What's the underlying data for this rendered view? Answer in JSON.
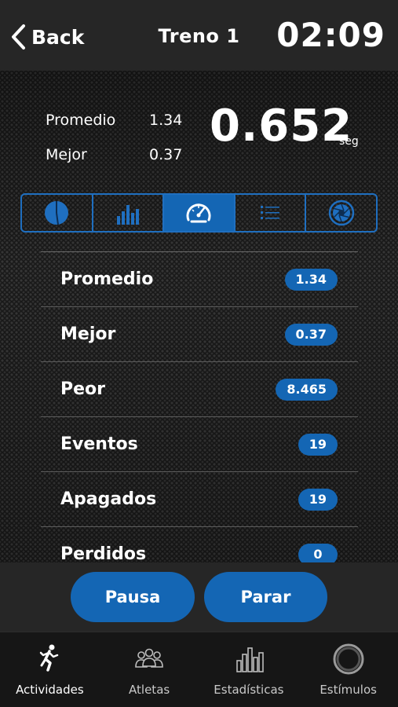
{
  "header": {
    "back_label": "Back",
    "title": "Treno 1",
    "clock": "02:09"
  },
  "summary": {
    "rows": [
      {
        "label": "Promedio",
        "value": "1.34"
      },
      {
        "label": "Mejor",
        "value": "0.37"
      }
    ],
    "current_value": "0.652",
    "unit": "seg"
  },
  "view_tabs": [
    {
      "icon": "pie-chart-icon",
      "active": false
    },
    {
      "icon": "bar-chart-icon",
      "active": false
    },
    {
      "icon": "speedometer-icon",
      "active": true
    },
    {
      "icon": "list-icon",
      "active": false
    },
    {
      "icon": "shutter-icon",
      "active": false
    }
  ],
  "stats": [
    {
      "label": "Promedio",
      "value": "1.34"
    },
    {
      "label": "Mejor",
      "value": "0.37"
    },
    {
      "label": "Peor",
      "value": "8.465"
    },
    {
      "label": "Eventos",
      "value": "19"
    },
    {
      "label": "Apagados",
      "value": "19"
    },
    {
      "label": "Perdidos",
      "value": "0"
    }
  ],
  "actions": {
    "pause_label": "Pausa",
    "stop_label": "Parar"
  },
  "tabbar": [
    {
      "label": "Actividades",
      "icon": "runner-icon",
      "active": true
    },
    {
      "label": "Atletas",
      "icon": "athletes-icon",
      "active": false
    },
    {
      "label": "Estadísticas",
      "icon": "stats-icon",
      "active": false
    },
    {
      "label": "Estímulos",
      "icon": "stimulus-ring-icon",
      "active": false
    }
  ],
  "colors": {
    "accent": "#1466b4",
    "background": "#1f1f1f"
  }
}
